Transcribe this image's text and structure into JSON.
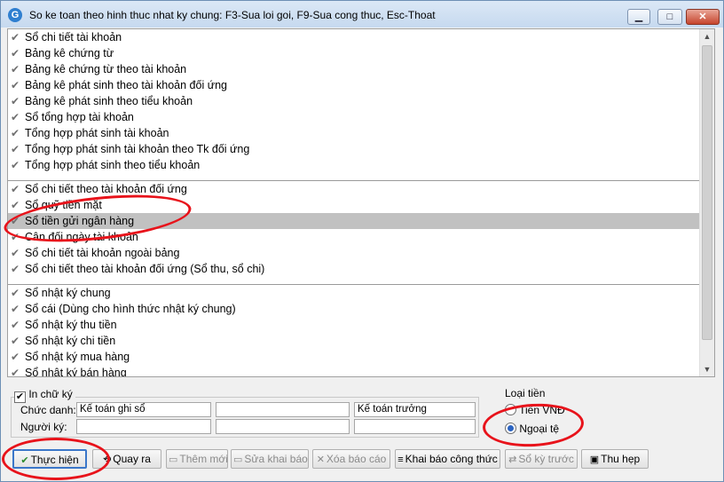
{
  "window": {
    "title": "So ke toan theo hinh thuc nhat ky chung: F3-Sua loi goi, F9-Sua cong thuc, Esc-Thoat",
    "app_icon_glyph": "G",
    "minimize_glyph": "▁",
    "maximize_glyph": "□",
    "close_glyph": "✕"
  },
  "icons": {
    "check": "✔",
    "scroll_up": "▲",
    "scroll_down": "▼"
  },
  "report_groups": [
    {
      "items": [
        {
          "label": "Sổ chi tiết tài khoản"
        },
        {
          "label": "Bảng kê chứng từ"
        },
        {
          "label": "Bảng kê chứng từ theo tài khoản"
        },
        {
          "label": "Bảng kê phát sinh theo tài khoản đối ứng"
        },
        {
          "label": "Bảng kê phát sinh theo tiểu khoản"
        },
        {
          "label": "Sổ tổng hợp tài khoản"
        },
        {
          "label": "Tổng hợp phát sinh tài khoản"
        },
        {
          "label": "Tổng hợp phát sinh tài khoản theo Tk đối ứng"
        },
        {
          "label": "Tổng hợp phát sinh theo tiểu khoản"
        }
      ]
    },
    {
      "items": [
        {
          "label": "Sổ chi tiết theo tài khoản đối ứng"
        },
        {
          "label": "Sổ quỹ tiền mặt"
        },
        {
          "label": "Sổ tiền gửi ngân hàng",
          "selected": true
        },
        {
          "label": "Cân đối ngày tài khoản"
        },
        {
          "label": "Sổ chi tiết tài khoản ngoài bảng"
        },
        {
          "label": "Sổ chi tiết theo tài khoản đối ứng (Sổ thu, sổ chi)"
        }
      ]
    },
    {
      "items": [
        {
          "label": "Sổ nhật ký chung"
        },
        {
          "label": "Sổ cái (Dùng cho hình thức nhật ký chung)"
        },
        {
          "label": "Sổ nhật ký thu tiền"
        },
        {
          "label": "Sổ nhật ký chi tiền"
        },
        {
          "label": "Sổ nhật ký mua hàng"
        },
        {
          "label": "Sổ nhật ký bán hàng"
        }
      ]
    }
  ],
  "signature": {
    "checkbox_label": "In chữ ký",
    "checked": true,
    "title_label": "Chức danh:",
    "signer_label": "Người ký:",
    "title_fields": [
      "Kế toán ghi sổ",
      "",
      "Kế toán trưởng"
    ],
    "signer_fields": [
      "",
      "",
      ""
    ]
  },
  "currency": {
    "label": "Loại tiền",
    "options": [
      {
        "label": "Tiền VNĐ",
        "selected": false
      },
      {
        "label": "Ngoại tệ",
        "selected": true
      }
    ]
  },
  "buttons": [
    {
      "label": "Thực hiện",
      "icon": "✔",
      "enabled": true
    },
    {
      "label": "Quay ra",
      "icon": "⟲",
      "enabled": true
    },
    {
      "label": "Thêm mới",
      "icon": "▭",
      "enabled": false
    },
    {
      "label": "Sửa khai báo",
      "icon": "▭",
      "enabled": false
    },
    {
      "label": "Xóa báo cáo",
      "icon": "✕",
      "enabled": false
    },
    {
      "label": "Khai báo công thức",
      "icon": "≡",
      "enabled": true
    },
    {
      "label": "Sổ kỳ trước",
      "icon": "⇄",
      "enabled": false
    },
    {
      "label": "Thu hẹp",
      "icon": "▣",
      "enabled": true
    }
  ],
  "annotation_color": "#e8131b"
}
